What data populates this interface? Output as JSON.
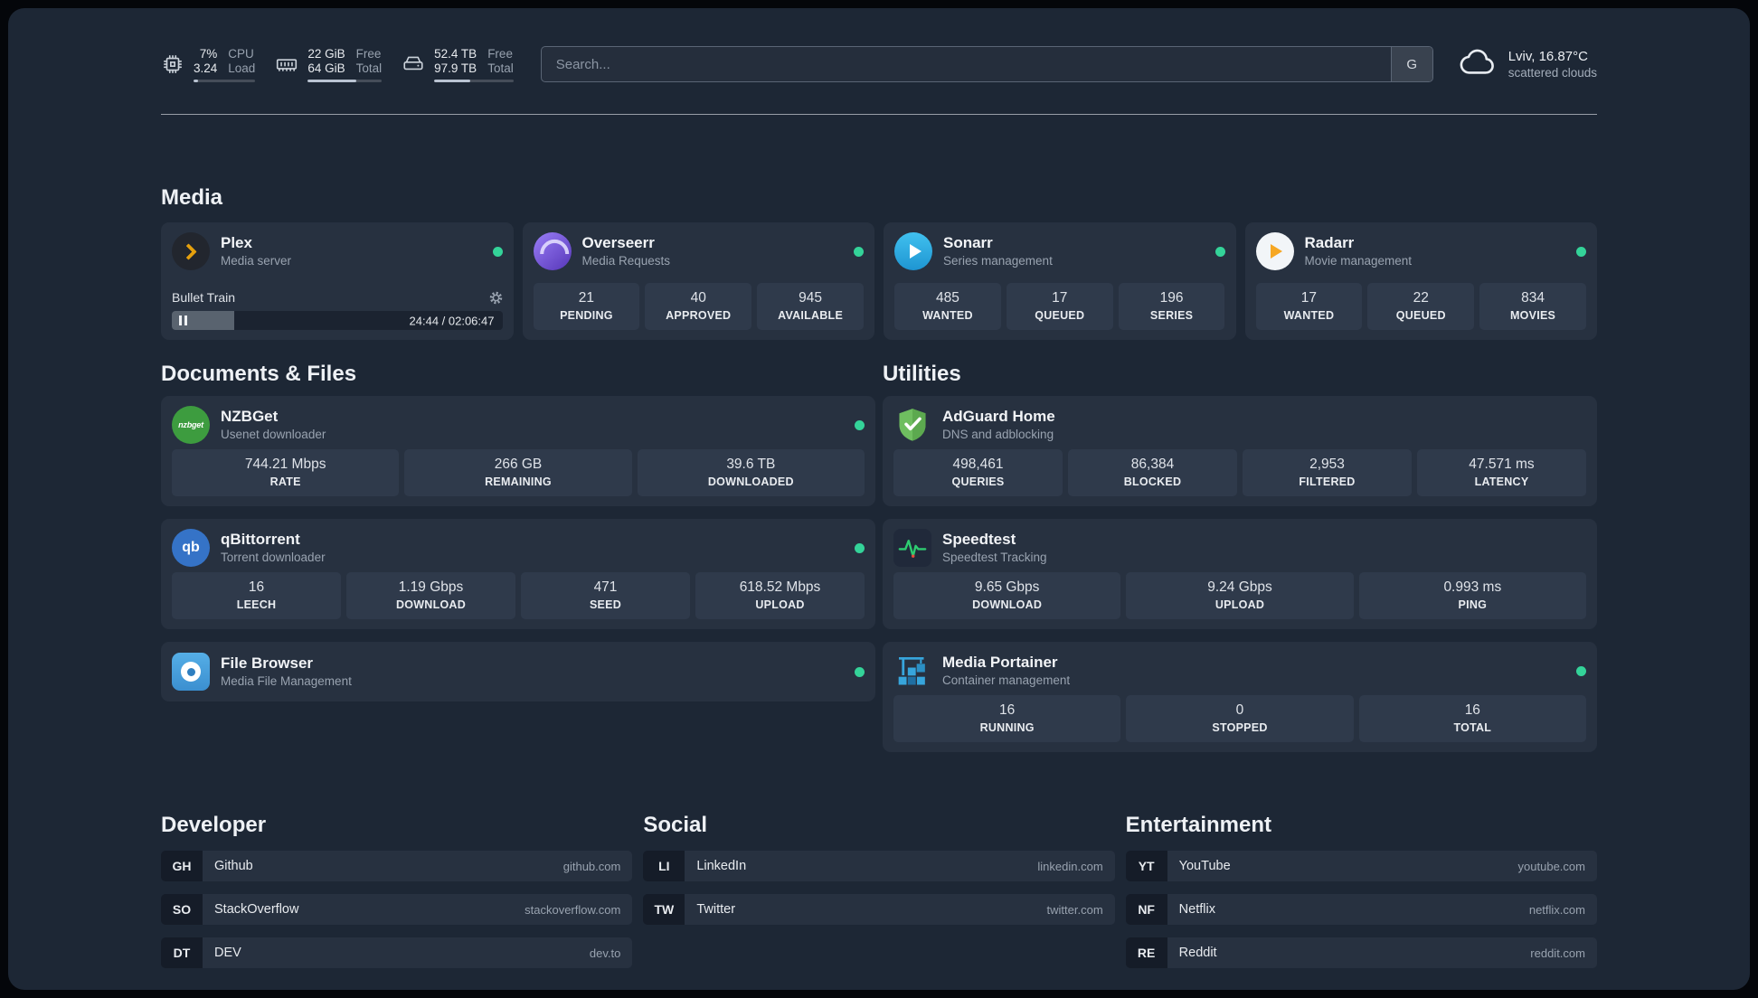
{
  "theme": {
    "background": "#1d2735",
    "card_bg": "#273140",
    "stat_bg": "#2f3a4b",
    "status_green": "#34d399",
    "text_secondary": "#99a3b0"
  },
  "topbar": {
    "cpu": {
      "value1": "7%",
      "value2": "3.24",
      "label1": "CPU",
      "label2": "Load",
      "percent": 7
    },
    "memory": {
      "value1": "22 GiB",
      "value2": "64 GiB",
      "label1": "Free",
      "label2": "Total",
      "percent": 66
    },
    "disk": {
      "value1": "52.4 TB",
      "value2": "97.9 TB",
      "label1": "Free",
      "label2": "Total",
      "percent": 46
    },
    "search": {
      "placeholder": "Search...",
      "button_label": "G"
    },
    "weather": {
      "location": "Lviv, 16.87°C",
      "condition": "scattered clouds"
    }
  },
  "sections": {
    "media": {
      "title": "Media",
      "cards": [
        {
          "name": "Plex",
          "description": "Media server",
          "status": "online",
          "player": {
            "track": "Bullet Train",
            "time": "24:44 / 02:06:47",
            "progress_percent": 19
          }
        },
        {
          "name": "Overseerr",
          "description": "Media Requests",
          "status": "online",
          "stats": [
            {
              "value": "21",
              "label": "PENDING"
            },
            {
              "value": "40",
              "label": "APPROVED"
            },
            {
              "value": "945",
              "label": "AVAILABLE"
            }
          ]
        },
        {
          "name": "Sonarr",
          "description": "Series management",
          "status": "online",
          "stats": [
            {
              "value": "485",
              "label": "WANTED"
            },
            {
              "value": "17",
              "label": "QUEUED"
            },
            {
              "value": "196",
              "label": "SERIES"
            }
          ]
        },
        {
          "name": "Radarr",
          "description": "Movie management",
          "status": "online",
          "stats": [
            {
              "value": "17",
              "label": "WANTED"
            },
            {
              "value": "22",
              "label": "QUEUED"
            },
            {
              "value": "834",
              "label": "MOVIES"
            }
          ]
        }
      ]
    },
    "documents": {
      "title": "Documents & Files",
      "cards": [
        {
          "name": "NZBGet",
          "description": "Usenet downloader",
          "status": "online",
          "stats": [
            {
              "value": "744.21 Mbps",
              "label": "RATE"
            },
            {
              "value": "266 GB",
              "label": "REMAINING"
            },
            {
              "value": "39.6 TB",
              "label": "DOWNLOADED"
            }
          ]
        },
        {
          "name": "qBittorrent",
          "description": "Torrent downloader",
          "status": "online",
          "stats": [
            {
              "value": "16",
              "label": "LEECH"
            },
            {
              "value": "1.19 Gbps",
              "label": "DOWNLOAD"
            },
            {
              "value": "471",
              "label": "SEED"
            },
            {
              "value": "618.52 Mbps",
              "label": "UPLOAD"
            }
          ]
        },
        {
          "name": "File Browser",
          "description": "Media File Management",
          "status": "online",
          "stats": []
        }
      ]
    },
    "utilities": {
      "title": "Utilities",
      "cards": [
        {
          "name": "AdGuard Home",
          "description": "DNS and adblocking",
          "stats": [
            {
              "value": "498,461",
              "label": "QUERIES"
            },
            {
              "value": "86,384",
              "label": "BLOCKED"
            },
            {
              "value": "2,953",
              "label": "FILTERED"
            },
            {
              "value": "47.571 ms",
              "label": "LATENCY"
            }
          ]
        },
        {
          "name": "Speedtest",
          "description": "Speedtest Tracking",
          "stats": [
            {
              "value": "9.65 Gbps",
              "label": "DOWNLOAD"
            },
            {
              "value": "9.24 Gbps",
              "label": "UPLOAD"
            },
            {
              "value": "0.993 ms",
              "label": "PING"
            }
          ]
        },
        {
          "name": "Media Portainer",
          "description": "Container management",
          "status": "online",
          "stats": [
            {
              "value": "16",
              "label": "RUNNING"
            },
            {
              "value": "0",
              "label": "STOPPED"
            },
            {
              "value": "16",
              "label": "TOTAL"
            }
          ]
        }
      ]
    },
    "developer": {
      "title": "Developer",
      "bookmarks": [
        {
          "abbr": "GH",
          "name": "Github",
          "url": "github.com"
        },
        {
          "abbr": "SO",
          "name": "StackOverflow",
          "url": "stackoverflow.com"
        },
        {
          "abbr": "DT",
          "name": "DEV",
          "url": "dev.to"
        }
      ]
    },
    "social": {
      "title": "Social",
      "bookmarks": [
        {
          "abbr": "LI",
          "name": "LinkedIn",
          "url": "linkedin.com"
        },
        {
          "abbr": "TW",
          "name": "Twitter",
          "url": "twitter.com"
        }
      ]
    },
    "entertainment": {
      "title": "Entertainment",
      "bookmarks": [
        {
          "abbr": "YT",
          "name": "YouTube",
          "url": "youtube.com"
        },
        {
          "abbr": "NF",
          "name": "Netflix",
          "url": "netflix.com"
        },
        {
          "abbr": "RE",
          "name": "Reddit",
          "url": "reddit.com"
        }
      ]
    }
  }
}
